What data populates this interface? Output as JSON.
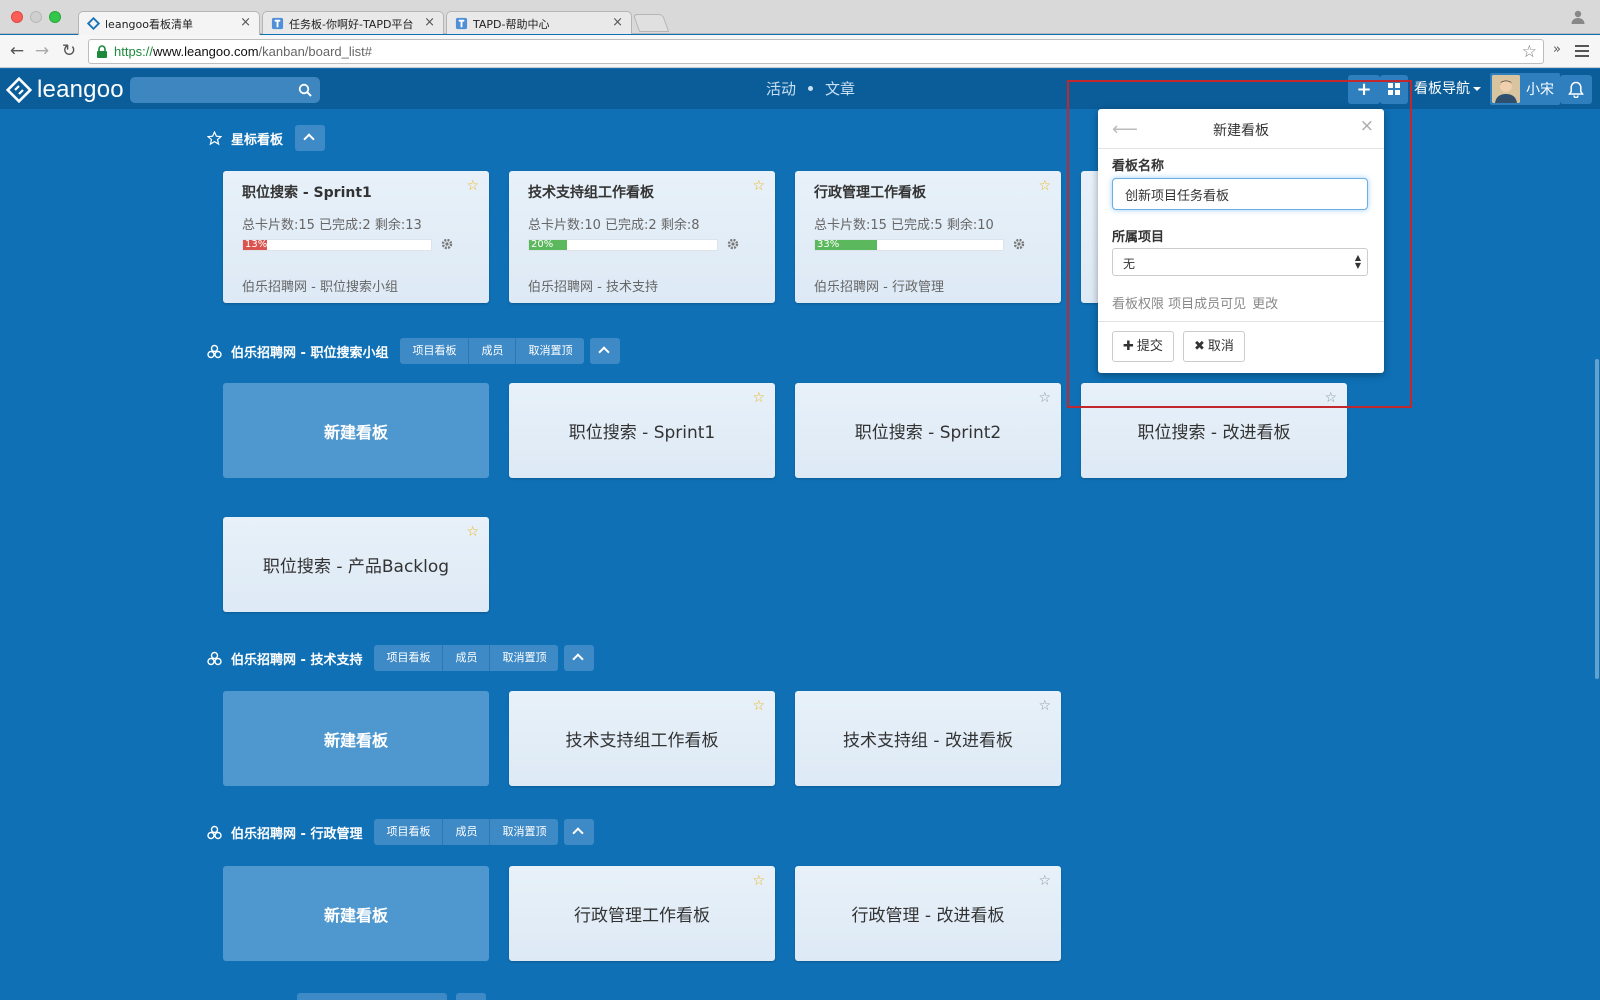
{
  "browser": {
    "tabs": [
      {
        "label": "leangoo看板清单",
        "active": true
      },
      {
        "label": "任务板-你啊好-TAPD平台",
        "active": false
      },
      {
        "label": "TAPD-帮助中心",
        "active": false
      }
    ],
    "url_scheme": "https://",
    "url_host": "www.leangoo.com",
    "url_path": "/kanban/board_list#"
  },
  "header": {
    "logo_text": "leangoo",
    "search_placeholder": "",
    "nav": [
      "活动",
      "文章"
    ],
    "plus_label": "+",
    "board_nav_label": "看板导航",
    "user_name": "小宋"
  },
  "starred": {
    "title": "星标看板",
    "cards": [
      {
        "title": "职位搜索 - Sprint1",
        "stats": "总卡片数:15 已完成:2 剩余:13",
        "progress_pct": 13,
        "progress_label": "13%",
        "progress_color": "#d9534f",
        "project": "伯乐招聘网 - 职位搜索小组"
      },
      {
        "title": "技术支持组工作看板",
        "stats": "总卡片数:10 已完成:2 剩余:8",
        "progress_pct": 20,
        "progress_label": "20%",
        "progress_color": "#5cb85c",
        "project": "伯乐招聘网 - 技术支持"
      },
      {
        "title": "行政管理工作看板",
        "stats": "总卡片数:15 已完成:5 剩余:10",
        "progress_pct": 33,
        "progress_label": "33%",
        "progress_color": "#5cb85c",
        "project": "伯乐招聘网 - 行政管理"
      }
    ]
  },
  "groups": [
    {
      "title": "伯乐招聘网 - 职位搜索小组",
      "buttons": [
        "项目看板",
        "成员",
        "取消置顶"
      ],
      "new_label": "新建看板",
      "boards": [
        {
          "title": "职位搜索 - Sprint1",
          "starred": true
        },
        {
          "title": "职位搜索 - Sprint2",
          "starred": false
        },
        {
          "title": "职位搜索 - 改进看板",
          "starred": false
        },
        {
          "title": "职位搜索 - 产品Backlog",
          "starred": true
        }
      ]
    },
    {
      "title": "伯乐招聘网 - 技术支持",
      "buttons": [
        "项目看板",
        "成员",
        "取消置顶"
      ],
      "new_label": "新建看板",
      "boards": [
        {
          "title": "技术支持组工作看板",
          "starred": true
        },
        {
          "title": "技术支持组 - 改进看板",
          "starred": false
        }
      ]
    },
    {
      "title": "伯乐招聘网 - 行政管理",
      "buttons": [
        "项目看板",
        "成员",
        "取消置顶"
      ],
      "new_label": "新建看板",
      "boards": [
        {
          "title": "行政管理工作看板",
          "starred": true
        },
        {
          "title": "行政管理 - 改进看板",
          "starred": false
        }
      ]
    }
  ],
  "popover": {
    "title": "新建看板",
    "name_label": "看板名称",
    "name_value": "创新项目任务看板",
    "project_label": "所属项目",
    "project_value": "无",
    "permission_text": "看板权限 项目成员可见",
    "change_link": "更改",
    "submit_label": "提交",
    "cancel_label": "取消"
  },
  "colors": {
    "page_bg": "#0f70b5",
    "header_bg": "#0b5d9a",
    "star_on": "#f0b31b",
    "highlight_border": "#c1272d"
  }
}
